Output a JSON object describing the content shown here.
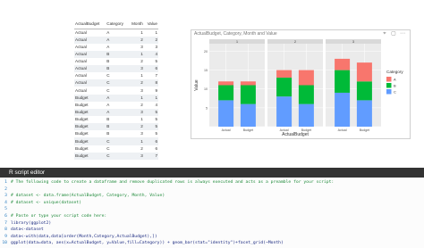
{
  "table": {
    "headers": [
      "ActualBudget",
      "Category",
      "Month",
      "Value"
    ],
    "rows": [
      [
        "Actual",
        "A",
        "1",
        "1"
      ],
      [
        "Actual",
        "A",
        "2",
        "2"
      ],
      [
        "Actual",
        "A",
        "3",
        "3"
      ],
      [
        "Actual",
        "B",
        "1",
        "4"
      ],
      [
        "Actual",
        "B",
        "2",
        "5"
      ],
      [
        "Actual",
        "B",
        "3",
        "6"
      ],
      [
        "Actual",
        "C",
        "1",
        "7"
      ],
      [
        "Actual",
        "C",
        "2",
        "8"
      ],
      [
        "Actual",
        "C",
        "3",
        "9"
      ],
      [
        "Budget",
        "A",
        "1",
        "1"
      ],
      [
        "Budget",
        "A",
        "2",
        "4"
      ],
      [
        "Budget",
        "A",
        "3",
        "5"
      ],
      [
        "Budget",
        "B",
        "1",
        "5"
      ],
      [
        "Budget",
        "B",
        "2",
        "5"
      ],
      [
        "Budget",
        "B",
        "3",
        "5"
      ],
      [
        "Budget",
        "C",
        "1",
        "6"
      ],
      [
        "Budget",
        "C",
        "2",
        "6"
      ],
      [
        "Budget",
        "C",
        "3",
        "7"
      ]
    ]
  },
  "visual": {
    "title": "ActualBudget, Category, Month and Value",
    "icons": [
      "pin-icon",
      "focus-mode-icon",
      "more-options-icon"
    ]
  },
  "chart_data": {
    "type": "bar",
    "stacked": true,
    "facets": [
      "1",
      "2",
      "3"
    ],
    "categories": [
      "Actual",
      "Budget"
    ],
    "xlabel": "ActualBudget",
    "ylabel": "Value",
    "ylim": [
      0,
      22
    ],
    "yticks": [
      0,
      5,
      10,
      15,
      20
    ],
    "legend": {
      "title": "Category",
      "position": "right",
      "entries": [
        "A",
        "B",
        "C"
      ]
    },
    "colors": {
      "A": "#f8766d",
      "B": "#00ba38",
      "C": "#619cff"
    },
    "facet_strip_color": "#d9d9d9",
    "panel_color": "#ebebeb",
    "series": [
      {
        "name": "A",
        "values": [
          [
            1,
            1
          ],
          [
            2,
            4
          ],
          [
            3,
            5
          ]
        ]
      },
      {
        "name": "B",
        "values": [
          [
            4,
            5
          ],
          [
            5,
            5
          ],
          [
            6,
            5
          ]
        ]
      },
      {
        "name": "C",
        "values": [
          [
            7,
            6
          ],
          [
            8,
            6
          ],
          [
            9,
            7
          ]
        ]
      }
    ]
  },
  "editor": {
    "title": "R script editor",
    "lines": [
      {
        "n": "1",
        "text": "# The following code to create a dataframe and remove duplicated rows is always executed and acts as a preamble for your script:",
        "comment": true
      },
      {
        "n": "2",
        "text": "",
        "comment": false
      },
      {
        "n": "3",
        "text": "# dataset <- data.frame(ActualBudget, Category, Month, Value)",
        "comment": true
      },
      {
        "n": "4",
        "text": "# dataset <- unique(dataset)",
        "comment": true
      },
      {
        "n": "5",
        "text": "",
        "comment": false
      },
      {
        "n": "6",
        "text": "# Paste or type your script code here:",
        "comment": true
      },
      {
        "n": "7",
        "text": "library(ggplot2)",
        "comment": false
      },
      {
        "n": "8",
        "text": "data<-dataset",
        "comment": false
      },
      {
        "n": "9",
        "text": "data<-with(data,data[order(Month,Category,ActualBudget),])",
        "comment": false
      },
      {
        "n": "10",
        "text": "ggplot(data=data, aes(x=ActualBudget, y=Value,fill=Category)) + geom_bar(stat=\"identity\")+facet_grid(~Month)",
        "comment": false
      }
    ]
  }
}
